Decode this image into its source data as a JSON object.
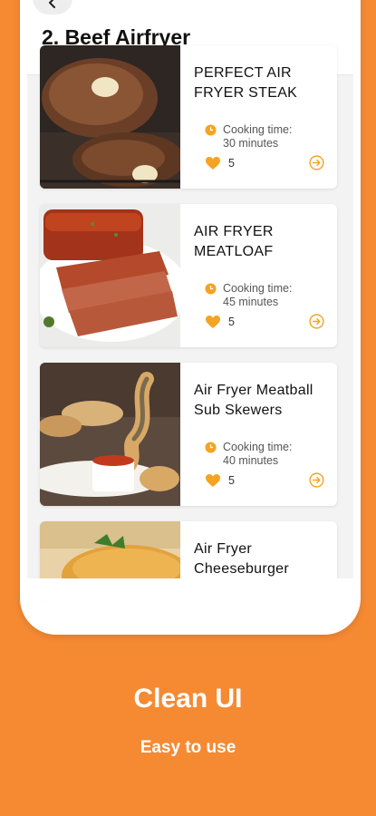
{
  "page": {
    "title": "2. Beef Airfryer"
  },
  "recipes": [
    {
      "title": "PERFECT AIR FRYER STEAK",
      "time_label": "Cooking time:",
      "time_value": "30 minutes",
      "likes": "5"
    },
    {
      "title": "AIR FRYER MEATLOAF",
      "time_label": "Cooking time:",
      "time_value": "45 minutes",
      "likes": "5"
    },
    {
      "title": "Air Fryer Meatball Sub Skewers",
      "time_label": "Cooking time:",
      "time_value": "40 minutes",
      "likes": "5"
    },
    {
      "title": "Air Fryer Cheeseburger"
    }
  ],
  "promo": {
    "headline": "Clean UI",
    "subline": "Easy to use"
  },
  "colors": {
    "accent": "#F5A323",
    "background": "#F58A33"
  },
  "icons": {
    "back": "back-arrow-icon",
    "clock": "clock-icon",
    "heart": "heart-icon",
    "open": "arrow-circle-icon"
  }
}
